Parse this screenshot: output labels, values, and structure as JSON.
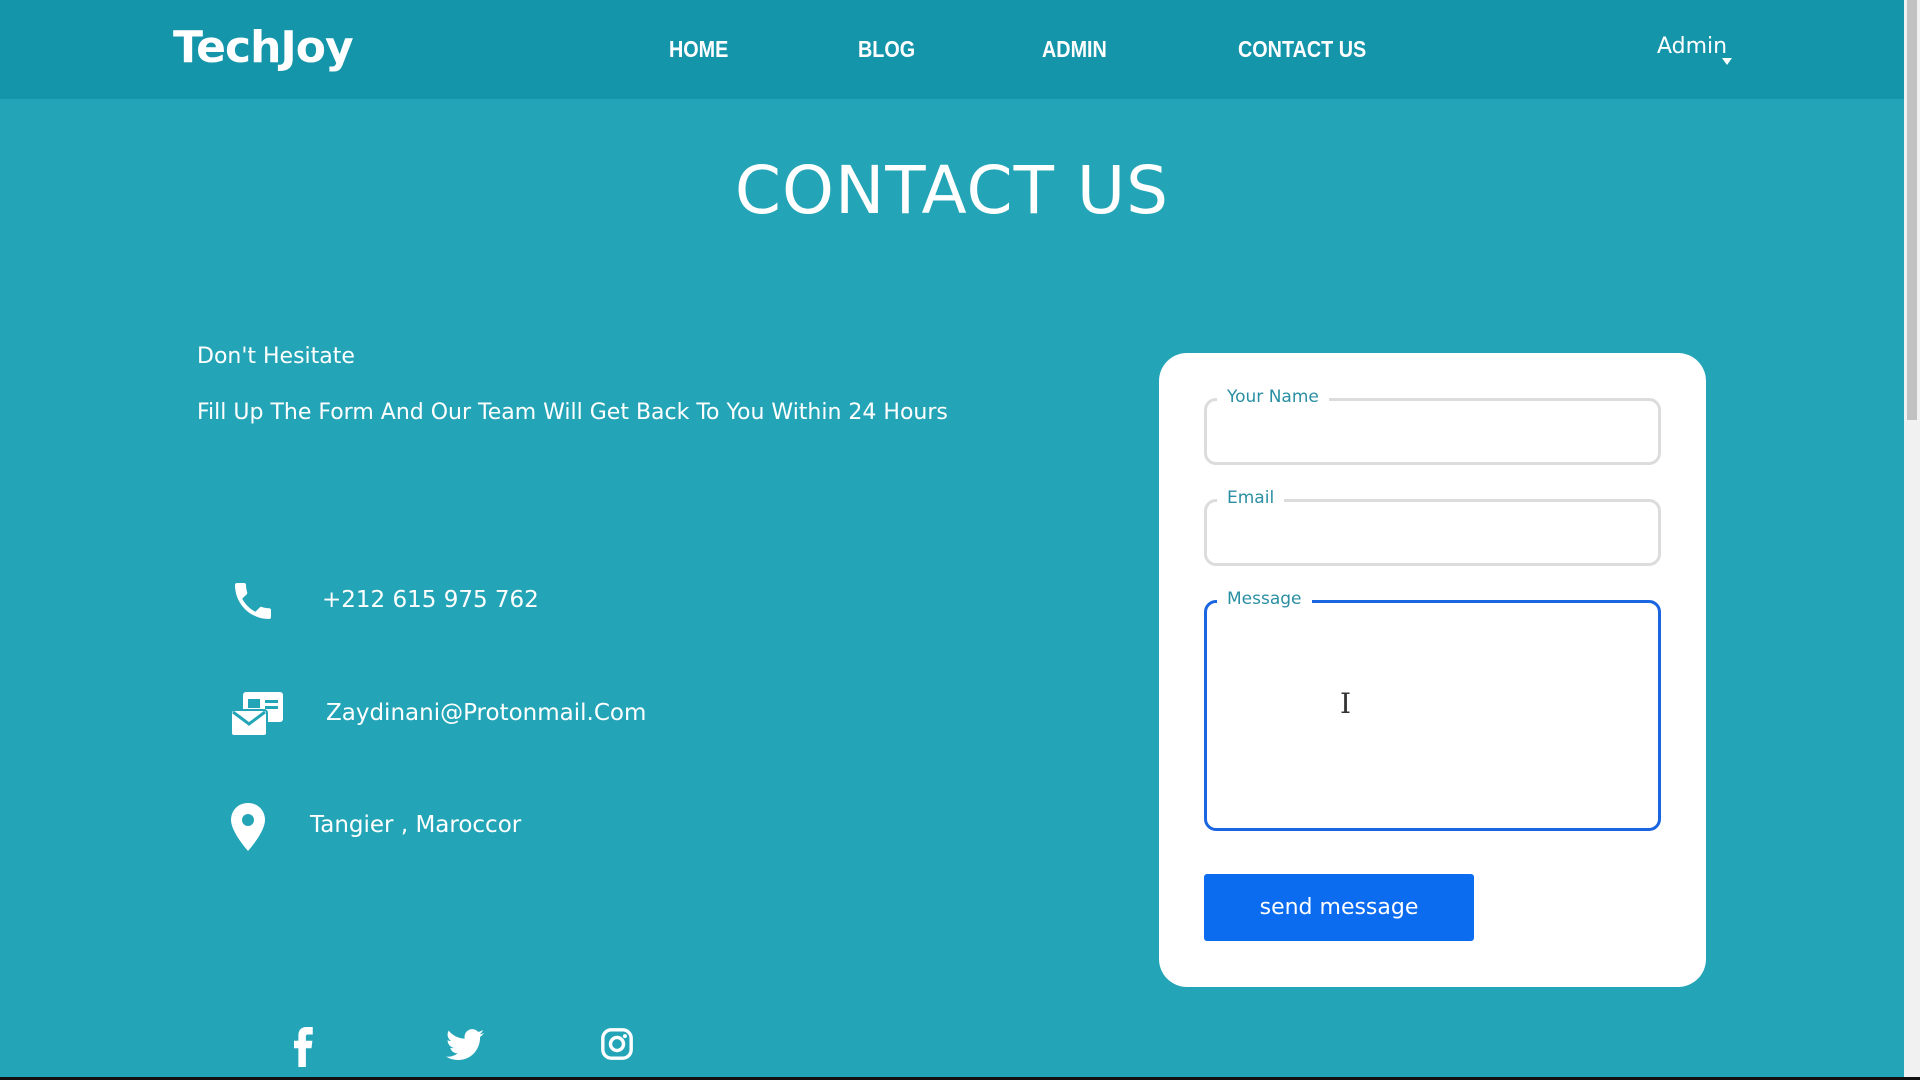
{
  "brand": {
    "logo_text": "TechJoy"
  },
  "nav": {
    "items": [
      {
        "label": "HOME"
      },
      {
        "label": "BLOG"
      },
      {
        "label": "ADMIN"
      },
      {
        "label": "CONTACT US"
      }
    ],
    "user_menu_label": "Admin"
  },
  "page": {
    "title": "CONTACT US",
    "tagline": "Don't Hesitate",
    "subtext": "Fill Up The Form And Our Team Will Get Back To You Within 24 Hours"
  },
  "contact_info": {
    "phone": {
      "icon": "phone-icon",
      "text": "+212 615 975 762"
    },
    "email": {
      "icon": "mail-icon",
      "text": "Zaydinani@Protonmail.Com"
    },
    "location": {
      "icon": "location-pin-icon",
      "text": "Tangier , Maroccor"
    }
  },
  "social": [
    {
      "icon": "facebook-icon"
    },
    {
      "icon": "twitter-icon"
    },
    {
      "icon": "instagram-icon"
    }
  ],
  "form": {
    "name_label": "Your Name",
    "name_value": "",
    "email_label": "Email",
    "email_value": "",
    "message_label": "Message",
    "message_value": "",
    "submit_label": "send message"
  },
  "colors": {
    "page_bg": "#24a5b7",
    "navbar_bg": "#1595aa",
    "button_bg": "#0b6cf0",
    "focus_border": "#1a66e0",
    "label_color": "#2a8fa3"
  }
}
